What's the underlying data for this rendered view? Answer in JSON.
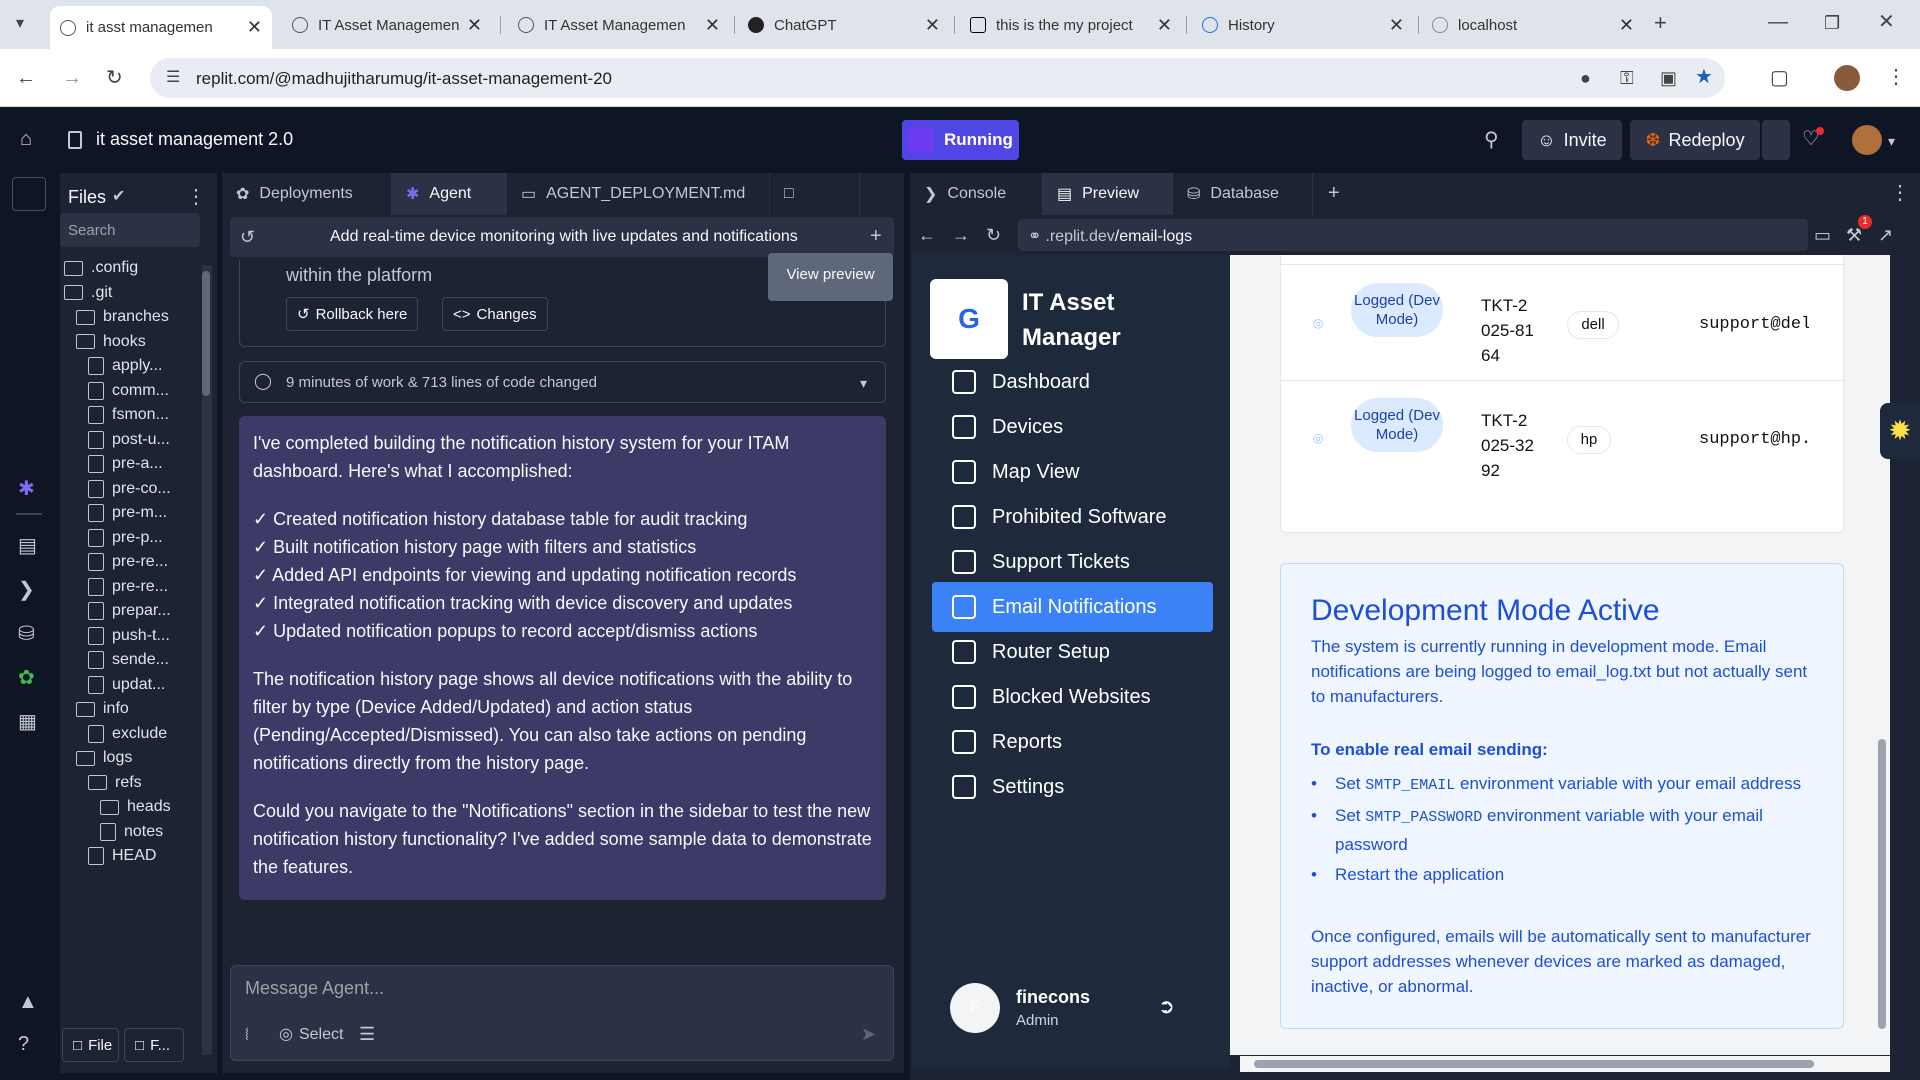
{
  "browser": {
    "tabs": [
      {
        "title": "it asst managemen"
      },
      {
        "title": "IT Asset Managemen"
      },
      {
        "title": "IT Asset Managemen"
      },
      {
        "title": "ChatGPT"
      },
      {
        "title": "this is the my project"
      },
      {
        "title": "History"
      },
      {
        "title": "localhost"
      }
    ],
    "url": "replit.com/@madhujitharumug/it-asset-management-20"
  },
  "replit": {
    "project_title": "it asset management 2.0",
    "run_label": "Running",
    "invite_label": "Invite",
    "redeploy_label": "Redeploy",
    "files_title": "Files",
    "search_placeholder": "Search",
    "file_tree": [
      ".config",
      ".git",
      "branches",
      "hooks",
      "apply...",
      "comm...",
      "fsmon...",
      "post-u...",
      "pre-a...",
      "pre-co...",
      "pre-m...",
      "pre-p...",
      "pre-re...",
      "pre-re...",
      "prepar...",
      "push-t...",
      "sende...",
      "updat...",
      "info",
      "exclude",
      "logs",
      "refs",
      "heads",
      "notes",
      "HEAD"
    ],
    "file_btn": "File",
    "f_btn": "F...",
    "tabs": {
      "deployments": "Deployments",
      "agent": "Agent",
      "doc": "AGENT_DEPLOYMENT.md",
      "console": "Console",
      "preview": "Preview",
      "database": "Database"
    },
    "agent": {
      "task": "Add real-time device monitoring with live updates and notifications",
      "partial_text": "within the platform",
      "view_preview": "View preview",
      "rollback": "Rollback here",
      "changes": "Changes",
      "summary": "9 minutes of work & 713 lines of code changed",
      "msg_p1": "I've completed building the notification history system for your ITAM dashboard. Here's what I accomplished:",
      "checks": [
        "✓ Created notification history database table for audit tracking",
        "✓ Built notification history page with filters and statistics",
        "✓ Added API endpoints for viewing and updating notification records",
        "✓ Integrated notification tracking with device discovery and updates",
        "✓ Updated notification popups to record accept/dismiss actions"
      ],
      "msg_p2": "The notification history page shows all device notifications with the ability to filter by type (Device Added/Updated) and action status (Pending/Accepted/Dismissed). You can also take actions on pending notifications directly from the history page.",
      "msg_p3": "Could you navigate to the \"Notifications\" section in the sidebar to test the new notification history functionality? I've added some sample data to demonstrate the features.",
      "input_placeholder": "Message Agent...",
      "select_label": "Select"
    },
    "preview_url_host": ".replit.dev",
    "preview_url_path": "/email-logs"
  },
  "app": {
    "brand": "IT Asset Manager",
    "nav": [
      "Dashboard",
      "Devices",
      "Map View",
      "Prohibited Software",
      "Support Tickets",
      "Email Notifications",
      "Router Setup",
      "Blocked Websites",
      "Reports",
      "Settings"
    ],
    "user": {
      "name": "finecons",
      "role": "Admin",
      "initial": "F"
    },
    "rows": [
      {
        "status": "Logged (Dev Mode)",
        "ticket": "TKT-2025-8164",
        "brand": "dell",
        "email": "support@dell"
      },
      {
        "status": "Logged (Dev Mode)",
        "ticket": "TKT-2025-3292",
        "brand": "hp",
        "email": "support@hp.c"
      }
    ],
    "dev": {
      "title": "Development Mode Active",
      "desc": "The system is currently running in development mode. Email notifications are being logged to email_log.txt but not actually sent to manufacturers.",
      "enable_title": "To enable real email sending:",
      "b1_pre": "Set ",
      "b1_code": "SMTP_EMAIL",
      "b1_post": " environment variable with your email address",
      "b2_pre": "Set ",
      "b2_code": "SMTP_PASSWORD",
      "b2_post": " environment variable with your email password",
      "b3": "Restart the application",
      "footer": "Once configured, emails will be automatically sent to manufacturer support addresses whenever devices are marked as damaged, inactive, or abnormal."
    }
  },
  "colors": {
    "accent": "#3b82f6",
    "run": "#4f46e5",
    "dev_title": "#1d4ed8"
  }
}
